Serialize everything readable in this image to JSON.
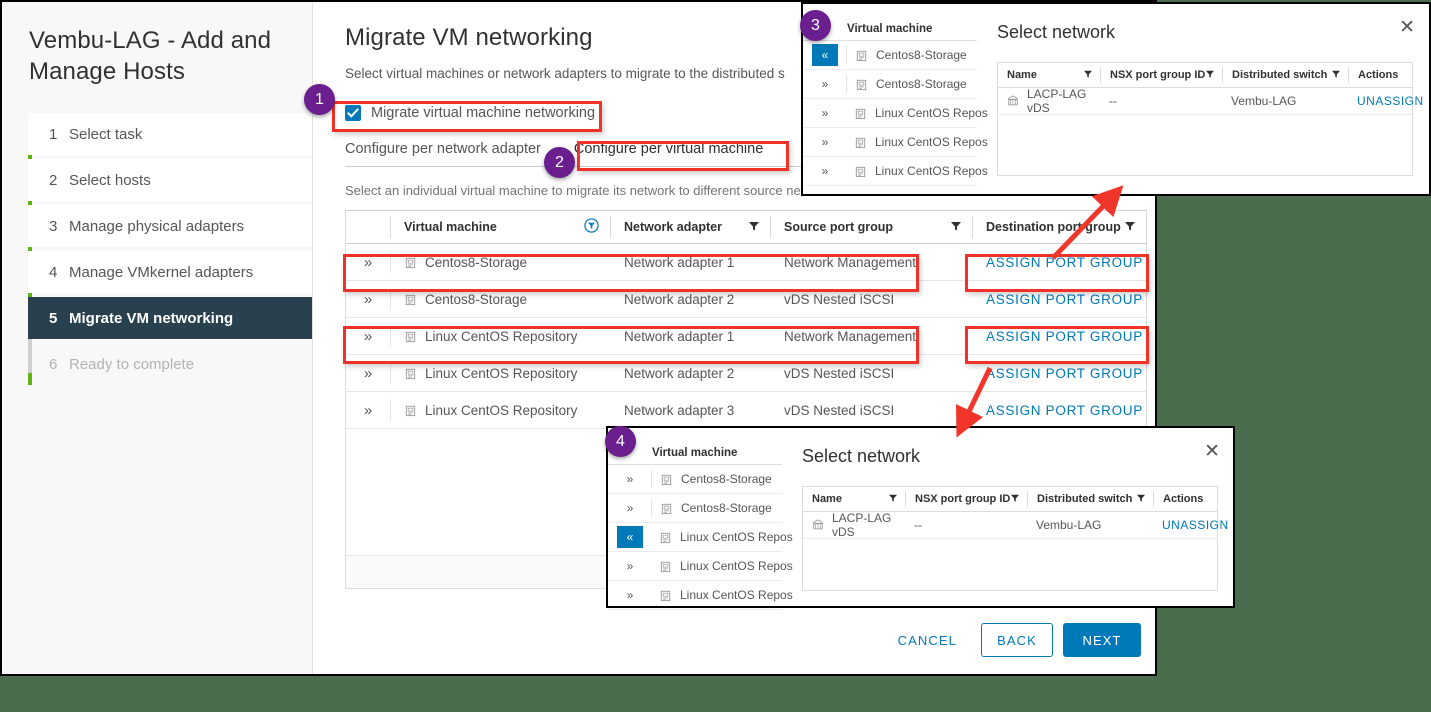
{
  "window": {
    "sidebar": {
      "title": "Vembu-LAG - Add and Manage Hosts",
      "steps": [
        {
          "num": "1",
          "label": "Select task",
          "state": "done"
        },
        {
          "num": "2",
          "label": "Select hosts",
          "state": "done"
        },
        {
          "num": "3",
          "label": "Manage physical adapters",
          "state": "done"
        },
        {
          "num": "4",
          "label": "Manage VMkernel adapters",
          "state": "done"
        },
        {
          "num": "5",
          "label": "Migrate VM networking",
          "state": "active"
        },
        {
          "num": "6",
          "label": "Ready to complete",
          "state": "disabled"
        }
      ]
    },
    "main": {
      "title": "Migrate VM networking",
      "subtitle": "Select virtual machines or network adapters to migrate to the distributed s",
      "checkbox_label": "Migrate virtual machine networking",
      "checkbox_checked": true,
      "tabs": [
        {
          "label": "Configure per network adapter",
          "selected": false
        },
        {
          "label": "Configure per virtual machine",
          "selected": true
        }
      ],
      "tab_subtitle": "Select an individual virtual machine to migrate its network to different source netw",
      "grid": {
        "columns": [
          "Virtual machine",
          "Network adapter",
          "Source port group",
          "Destination port group"
        ],
        "rows": [
          {
            "expand": "»",
            "vm": "Centos8-Storage",
            "adapter": "Network adapter 1",
            "source": "Network Management",
            "dest": "ASSIGN PORT GROUP"
          },
          {
            "expand": "»",
            "vm": "Centos8-Storage",
            "adapter": "Network adapter 2",
            "source": "vDS Nested iSCSI",
            "dest": "ASSIGN PORT GROUP"
          },
          {
            "expand": "»",
            "vm": "Linux CentOS Repository",
            "adapter": "Network adapter 1",
            "source": "Network Management",
            "dest": "ASSIGN PORT GROUP"
          },
          {
            "expand": "»",
            "vm": "Linux CentOS Repository",
            "adapter": "Network adapter 2",
            "source": "vDS Nested iSCSI",
            "dest": "ASSIGN PORT GROUP"
          },
          {
            "expand": "»",
            "vm": "Linux CentOS Repository",
            "adapter": "Network adapter 3",
            "source": "vDS Nested iSCSI",
            "dest": "ASSIGN PORT GROUP"
          }
        ]
      }
    },
    "footer": {
      "cancel": "CANCEL",
      "back": "BACK",
      "next": "NEXT"
    }
  },
  "dialog_top": {
    "badge": "3",
    "vmlist": {
      "header": "Virtual machine",
      "rows": [
        {
          "btn": "«",
          "selected": true,
          "name": "Centos8-Storage"
        },
        {
          "btn": "»",
          "selected": false,
          "name": "Centos8-Storage"
        },
        {
          "btn": "»",
          "selected": false,
          "name": "Linux CentOS Repos"
        },
        {
          "btn": "»",
          "selected": false,
          "name": "Linux CentOS Repos"
        },
        {
          "btn": "»",
          "selected": false,
          "name": "Linux CentOS Repos"
        }
      ]
    },
    "panel": {
      "title": "Select network",
      "close": "✕",
      "columns": [
        "Name",
        "NSX port group ID",
        "Distributed switch",
        "Actions"
      ],
      "rows": [
        {
          "name": "LACP-LAG vDS",
          "nsx": "--",
          "dswitch": "Vembu-LAG",
          "action": "UNASSIGN"
        }
      ]
    }
  },
  "dialog_bottom": {
    "badge": "4",
    "vmlist": {
      "header": "Virtual machine",
      "rows": [
        {
          "btn": "»",
          "selected": false,
          "name": "Centos8-Storage"
        },
        {
          "btn": "»",
          "selected": false,
          "name": "Centos8-Storage"
        },
        {
          "btn": "«",
          "selected": true,
          "name": "Linux CentOS Repos"
        },
        {
          "btn": "»",
          "selected": false,
          "name": "Linux CentOS Repos"
        },
        {
          "btn": "»",
          "selected": false,
          "name": "Linux CentOS Repos"
        }
      ]
    },
    "panel": {
      "title": "Select network",
      "close": "✕",
      "columns": [
        "Name",
        "NSX port group ID",
        "Distributed switch",
        "Actions"
      ],
      "rows": [
        {
          "name": "LACP-LAG vDS",
          "nsx": "--",
          "dswitch": "Vembu-LAG",
          "action": "UNASSIGN"
        }
      ]
    }
  },
  "annotations": {
    "badges": [
      "1",
      "2",
      "3",
      "4"
    ],
    "accent_red": "#f03228",
    "accent_purple": "#6b1f8e",
    "accent_blue": "#0079b8",
    "background": "#4a6d4d"
  }
}
